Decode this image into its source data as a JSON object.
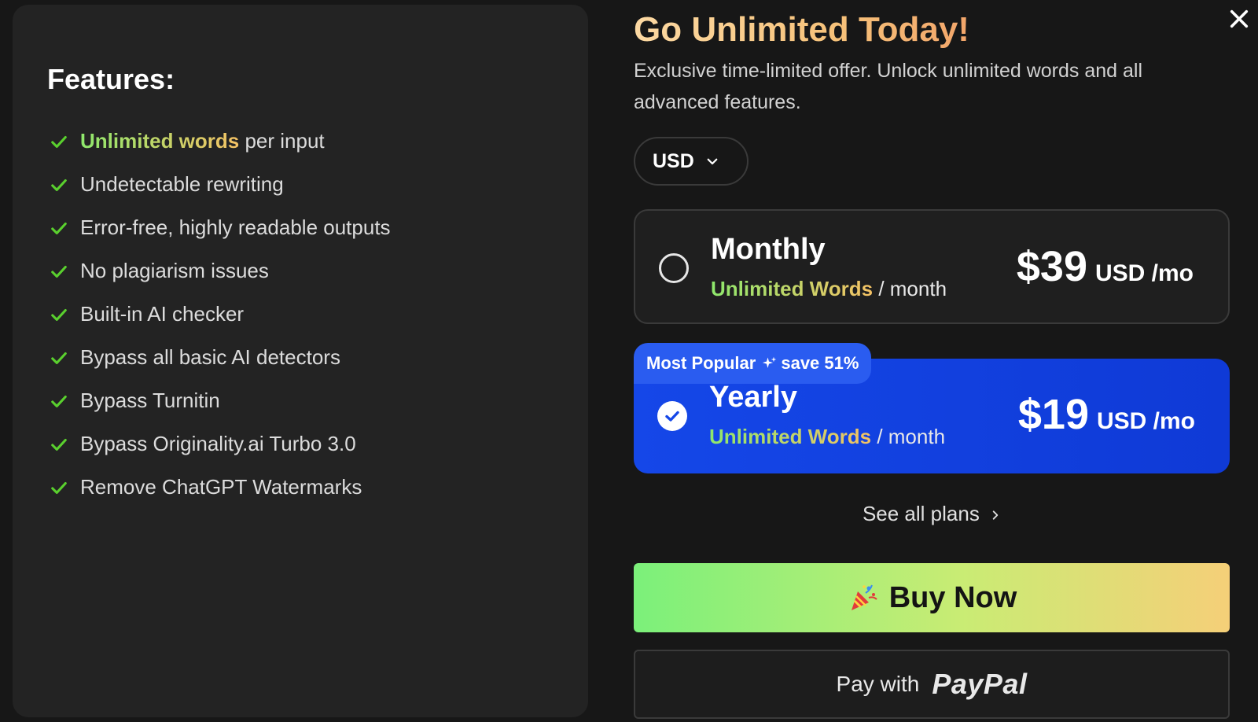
{
  "features": {
    "title": "Features:",
    "items": [
      {
        "highlight": "Unlimited words",
        "text": " per input"
      },
      {
        "highlight": "",
        "text": "Undetectable rewriting"
      },
      {
        "highlight": "",
        "text": "Error-free, highly readable outputs"
      },
      {
        "highlight": "",
        "text": "No plagiarism issues"
      },
      {
        "highlight": "",
        "text": "Built-in AI checker"
      },
      {
        "highlight": "",
        "text": "Bypass all basic AI detectors"
      },
      {
        "highlight": "",
        "text": "Bypass Turnitin"
      },
      {
        "highlight": "",
        "text": "Bypass Originality.ai Turbo 3.0"
      },
      {
        "highlight": "",
        "text": "Remove ChatGPT Watermarks"
      }
    ]
  },
  "offer": {
    "headline": "Go Unlimited Today!",
    "subtitle": "Exclusive time-limited offer. Unlock unlimited words and all advanced features."
  },
  "currency": {
    "selected": "USD"
  },
  "plans": {
    "monthly": {
      "name": "Monthly",
      "highlight": "Unlimited Words",
      "period": " / month",
      "price": "$39",
      "unit": "USD /mo",
      "selected": false
    },
    "yearly": {
      "name": "Yearly",
      "highlight": "Unlimited Words",
      "period": " / month",
      "price": "$19",
      "unit": "USD /mo",
      "selected": true,
      "badge": "Most Popular",
      "save": "save 51%"
    }
  },
  "links": {
    "see_all": "See all plans"
  },
  "actions": {
    "buy": "Buy Now",
    "pay_with": "Pay with",
    "paypal": "PayPal"
  },
  "colors": {
    "accent_blue": "#1547e8",
    "check_green": "#5ad02e",
    "gradient_green": "#7bf07a",
    "gradient_orange": "#f5cf78"
  },
  "icons": {
    "check": "check-icon",
    "close": "close-icon",
    "dropdown": "chevron-down-icon",
    "sparkle": "sparkle-icon",
    "party": "party-popper-icon"
  }
}
